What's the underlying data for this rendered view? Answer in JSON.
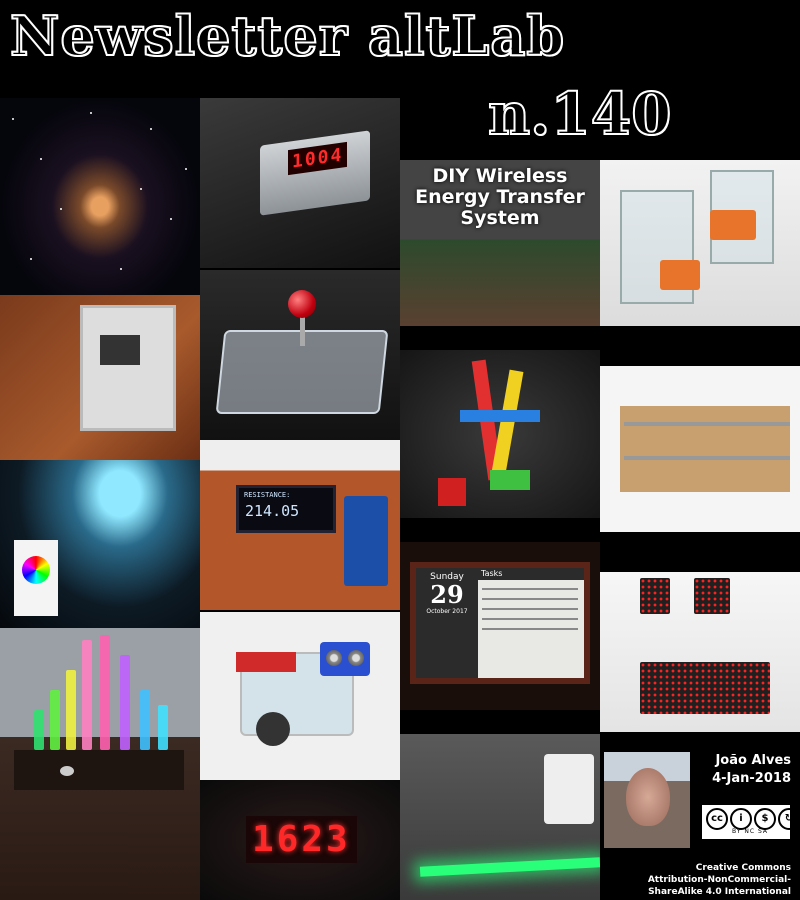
{
  "header": {
    "title": "Newsletter altLab",
    "issue": "n.140"
  },
  "tiles": {
    "diy_caption": "DIY Wireless Energy Transfer System",
    "timer_display": "1004",
    "oled_label": "RESISTANCE:",
    "oled_value": "214.05",
    "calendar_day": "Sunday",
    "calendar_date": "29",
    "calendar_month": "October 2017",
    "calendar_tasks": "Tasks",
    "clock_display": "1623"
  },
  "author": {
    "name": "João Alves",
    "date": "4-Jan-2018"
  },
  "license": {
    "badge_text": "BY NC SA",
    "line1": "Creative Commons",
    "line2": "Attribution-NonCommercial-",
    "line3": "ShareAlike 4.0 International"
  },
  "colors": {
    "background": "#000000",
    "accent_led_red": "#ff2828",
    "accent_led_green": "#2aff7a"
  }
}
